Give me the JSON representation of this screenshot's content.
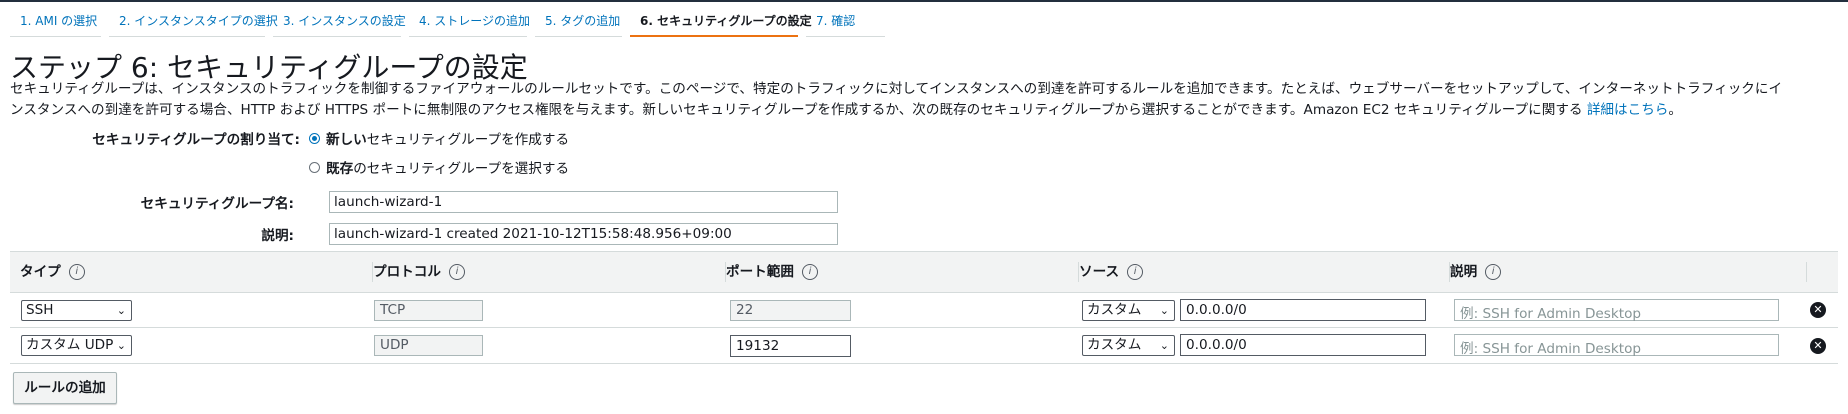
{
  "tabs": [
    {
      "label": "1. AMI の選択",
      "active": false
    },
    {
      "label": "2. インスタンスタイプの選択",
      "active": false
    },
    {
      "label": "3. インスタンスの設定",
      "active": false
    },
    {
      "label": "4. ストレージの追加",
      "active": false
    },
    {
      "label": "5. タグの追加",
      "active": false
    },
    {
      "label": "6. セキュリティグループの設定",
      "active": true
    },
    {
      "label": "7. 確認",
      "active": false
    }
  ],
  "heading": "ステップ 6: セキュリティグループの設定",
  "description": {
    "line1": "セキュリティグループは、インスタンスのトラフィックを制御するファイアウォールのルールセットです。このページで、特定のトラフィックに対してインスタンスへの到達を許可するルールを追加できます。たとえば、ウェブサーバーをセットアップして、インターネットトラフィックにイ",
    "line2": "ンスタンスへの到達を許可する場合、HTTP および HTTPS ポートに無制限のアクセス権限を与えます。新しいセキュリティグループを作成するか、次の既存のセキュリティグループから選択することができます。Amazon EC2 セキュリティグループに関する ",
    "link": "詳細はこちら",
    "end": "。"
  },
  "assign": {
    "label": "セキュリティグループの割り当て:",
    "option_new_bold": "新しい",
    "option_new_rest": "セキュリティグループを作成する",
    "option_existing_bold": "既存",
    "option_existing_rest": "のセキュリティグループを選択する"
  },
  "group_name": {
    "label": "セキュリティグループ名:",
    "value": "launch-wizard-1"
  },
  "group_desc": {
    "label": "説明:",
    "value": "launch-wizard-1 created 2021-10-12T15:58:48.956+09:00"
  },
  "table": {
    "headers": {
      "type": "タイプ",
      "protocol": "プロトコル",
      "port": "ポート範囲",
      "source": "ソース",
      "desc": "説明"
    },
    "info_icon": "i",
    "rows": [
      {
        "type": "SSH",
        "protocol": "TCP",
        "port": "22",
        "source_type": "カスタム",
        "source": "0.0.0.0/0",
        "desc_placeholder": "例: SSH for Admin Desktop"
      },
      {
        "type": "カスタム UDP",
        "protocol": "UDP",
        "port": "19132",
        "source_type": "カスタム",
        "source": "0.0.0.0/0",
        "desc_placeholder": "例: SSH for Admin Desktop"
      }
    ]
  },
  "add_rule_label": "ルールの追加",
  "icons": {
    "chevron": "⌄",
    "remove": "✕"
  },
  "colors": {
    "accent": "#ec7211",
    "link": "#0073bb"
  }
}
